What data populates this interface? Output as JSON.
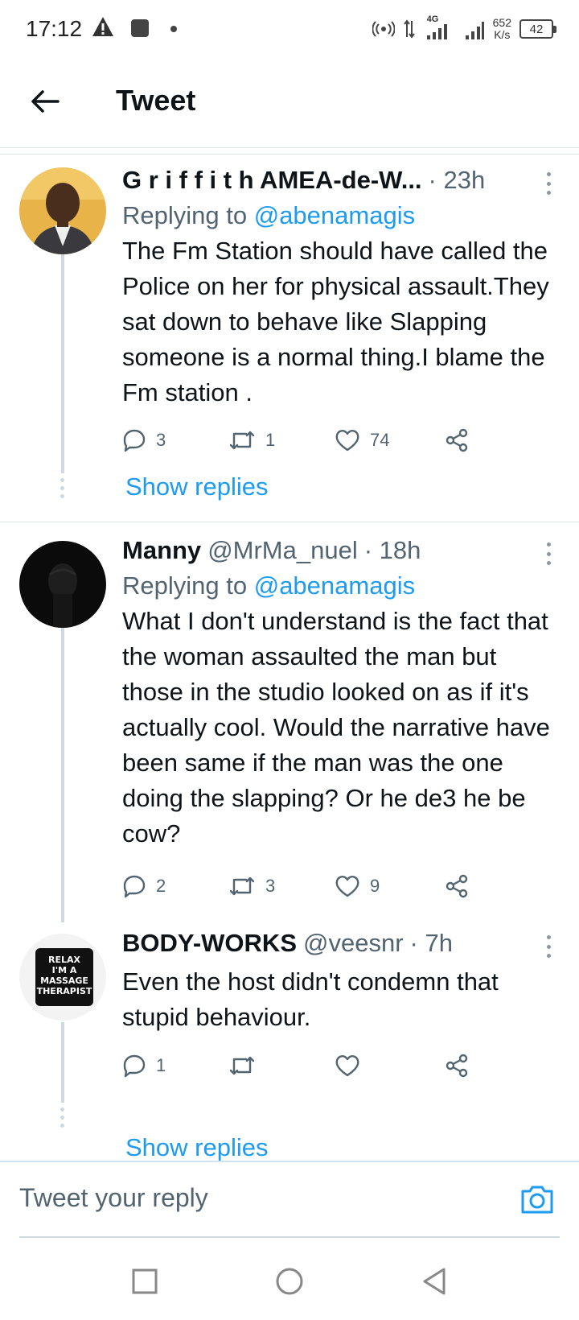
{
  "status_bar": {
    "time": "17:12",
    "network": "4G",
    "speed_value": "652",
    "speed_unit": "K/s",
    "battery": "42"
  },
  "header": {
    "title": "Tweet",
    "back_icon": "arrow-left-icon"
  },
  "tweets": [
    {
      "name": "G r i f f i t h AMEA-de-W...",
      "handle": "",
      "time": "· 23h",
      "replying_prefix": "Replying to ",
      "replying_to": "@abenamagis",
      "text": "The Fm Station should have called the Police on her for physical assault.They sat down to behave like Slapping someone is a normal thing.I blame the Fm station .",
      "replies": "3",
      "retweets": "1",
      "likes": "74",
      "show_replies": "Show replies"
    },
    {
      "name": "Manny",
      "handle": "@MrMa_nuel",
      "time": "· 18h",
      "replying_prefix": "Replying to ",
      "replying_to": "@abenamagis",
      "text": "What I don't understand is the fact that the woman assaulted the man but those in the studio looked on as if it's actually cool. Would the narrative have been same if the man was the one doing the slapping? Or he de3 he be cow?",
      "replies": "2",
      "retweets": "3",
      "likes": "9"
    },
    {
      "name": "BODY-WORKS",
      "handle": "@veesnr",
      "time": "· 7h",
      "text": "Even the host didn't condemn that stupid behaviour.",
      "replies": "1",
      "retweets": "",
      "likes": "",
      "show_replies": "Show replies",
      "avatar_text": [
        "RELAX",
        "I'M A",
        "MASSAGE",
        "THERAPIST"
      ]
    }
  ],
  "reply_bar": {
    "placeholder": "Tweet your reply",
    "camera_icon": "camera-icon"
  },
  "nav_bar": {
    "recents_icon": "square-icon",
    "home_icon": "circle-icon",
    "back_icon": "triangle-back-icon"
  },
  "colors": {
    "accent": "#1d9bf0",
    "secondary_text": "#536471",
    "divider": "#dde3e8"
  }
}
